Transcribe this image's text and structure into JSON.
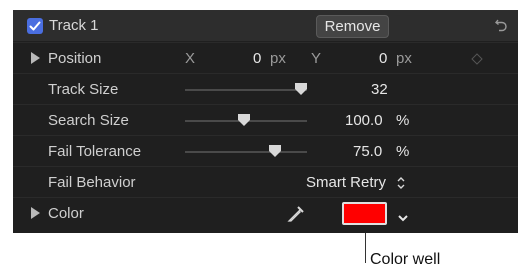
{
  "header": {
    "title": "Track 1",
    "remove_label": "Remove",
    "reset_icon": "reset-arrow-icon",
    "checked": true
  },
  "rows": {
    "position": {
      "label": "Position",
      "x_label": "X",
      "x_value": "0",
      "x_unit": "px",
      "y_label": "Y",
      "y_value": "0",
      "y_unit": "px",
      "keyframe_icon": "diamond-icon"
    },
    "track_size": {
      "label": "Track Size",
      "value": "32",
      "slider_fraction": 0.95
    },
    "search_size": {
      "label": "Search Size",
      "value": "100.0",
      "unit": "%",
      "slider_fraction": 0.48
    },
    "fail_tolerance": {
      "label": "Fail Tolerance",
      "value": "75.0",
      "unit": "%",
      "slider_fraction": 0.74
    },
    "fail_behavior": {
      "label": "Fail Behavior",
      "value": "Smart Retry",
      "stepper_icon": "up-down-chevrons-icon"
    },
    "color": {
      "label": "Color",
      "eyedropper_icon": "eyedropper-icon",
      "swatch_color": "#ff0000",
      "dropdown_icon": "chevron-down-icon"
    }
  },
  "callout": {
    "text": "Color well"
  },
  "colors": {
    "accent": "#4a6ee0",
    "panel_bg": "#1f1f1f"
  }
}
